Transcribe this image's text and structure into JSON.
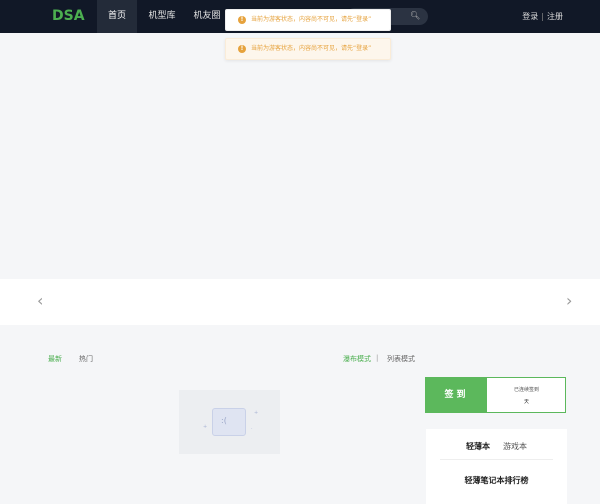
{
  "header": {
    "logo": "DSA",
    "nav": {
      "home": "首页",
      "models": "机型库",
      "friends": "机友圈"
    },
    "auth": {
      "login": "登录",
      "separator": "|",
      "register": "注册"
    }
  },
  "toasts": [
    {
      "message": "当前为游客状态，内容尚不可见，请先“登录”"
    },
    {
      "message": "当前为游客状态，内容尚不可见，请先“登录”"
    }
  ],
  "content": {
    "tabs": {
      "latest": "最新",
      "hot": "热门"
    },
    "modes": {
      "waterfall": "瀑布模式",
      "separator": "|",
      "list": "列表模式"
    }
  },
  "signin": {
    "button": "签到",
    "title": "已连续签到",
    "days": "天"
  },
  "ranking": {
    "tabs": {
      "light": "轻薄本",
      "game": "游戏本"
    },
    "title": "轻薄笔记本排行榜"
  },
  "colors": {
    "accent": "#4caf50",
    "nav_bg": "#111827",
    "warning": "#e6a23c"
  }
}
